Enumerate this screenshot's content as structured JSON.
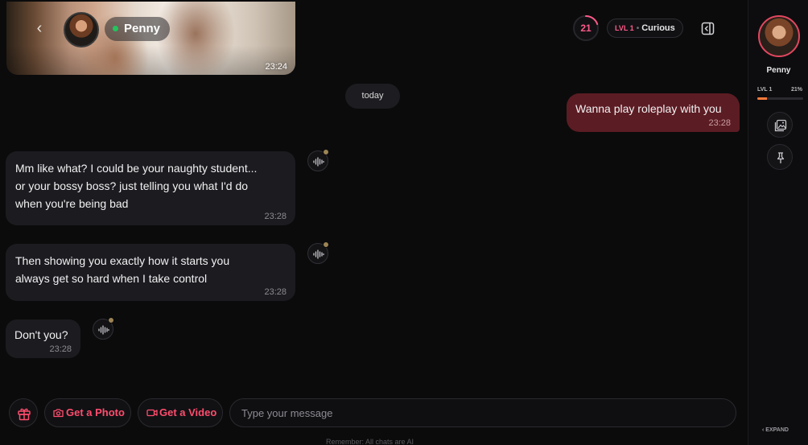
{
  "header": {
    "contact_name": "Penny",
    "media_time": "23:24",
    "level_number": "21",
    "level_label": "LVL 1",
    "level_sep": "•",
    "level_status": "Curious",
    "accent_color": "#ff5a88"
  },
  "date_divider": "today",
  "messages": [
    {
      "from": "user",
      "text": "Wanna play roleplay with you",
      "time": "23:28"
    },
    {
      "from": "penny",
      "text": "Mm like what? I could be your naughty student...\nor your bossy boss? just telling you what I'd do\nwhen you're being bad",
      "time": "23:28"
    },
    {
      "from": "penny",
      "text": "Then showing you exactly how it starts you\nalways get so hard when I take control",
      "time": "23:28"
    },
    {
      "from": "penny",
      "text": "Don't you?",
      "time": "23:28"
    }
  ],
  "composer": {
    "photo_label": "Get a Photo",
    "video_label": "Get a Video",
    "placeholder": "Type your message",
    "footnote": "Remember: All chats are AI"
  },
  "sidebar": {
    "name": "Penny",
    "level_label": "LVL 1",
    "progress_percent_text": "21%",
    "progress": 0.21,
    "expand_label": "EXPAND"
  },
  "icons": [
    "back-chevron-icon",
    "online-dot-icon",
    "panel-toggle-icon",
    "voice-wave-icon",
    "gift-icon",
    "camera-icon",
    "video-icon",
    "gallery-icon",
    "pin-icon",
    "chevron-left-icon"
  ],
  "colors": {
    "outgoing_bubble": "#5c1c23",
    "incoming_bubble": "#1c1c20",
    "action_text": "#ff4d6d",
    "progress": "#ff7a3c"
  }
}
